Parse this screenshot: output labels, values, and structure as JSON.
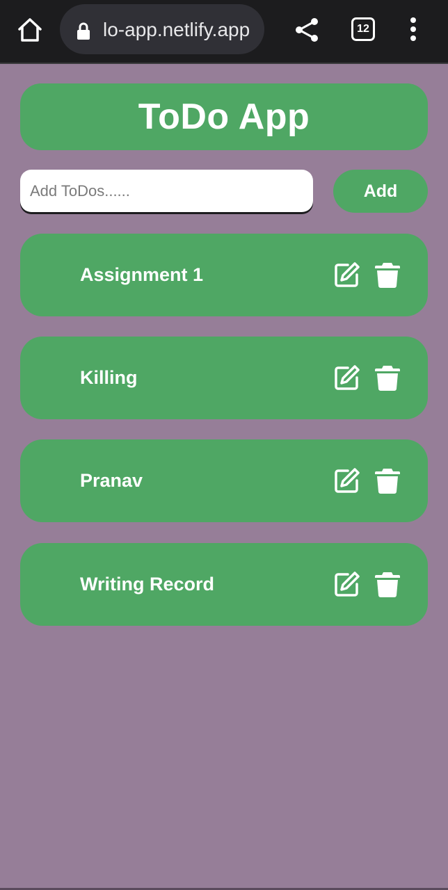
{
  "browser": {
    "url": "lo-app.netlify.app",
    "tab_count": "12"
  },
  "app": {
    "title": "ToDo App",
    "input_placeholder": "Add ToDos......",
    "input_value": "",
    "add_label": "Add"
  },
  "todos": [
    {
      "text": "Assignment 1"
    },
    {
      "text": "Killing"
    },
    {
      "text": "Pranav"
    },
    {
      "text": "Writing Record"
    }
  ],
  "icons": {
    "home": "home-icon",
    "lock": "lock-icon",
    "share": "share-icon",
    "tabs": "tabs-icon",
    "menu": "more-vert-icon",
    "edit": "edit-icon",
    "delete": "trash-icon"
  },
  "colors": {
    "background": "#967e98",
    "accent": "#4fa764",
    "browser_bar": "#1c1c1e",
    "text_light": "#ffffff"
  }
}
